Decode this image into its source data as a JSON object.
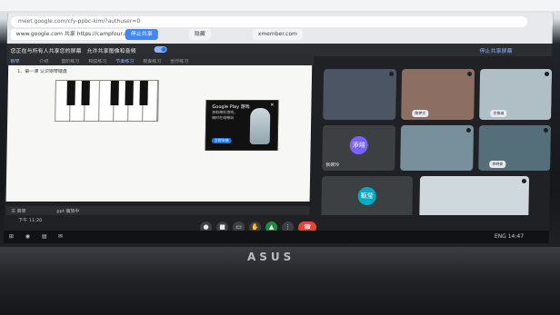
{
  "browser": {
    "url": "meet.google.com/cfy-ppbc-kim/?authuser=0",
    "tabs": [
      "www.google.com 共享 https://campfour.com",
      "停止共享",
      "隐藏",
      "xmember.com"
    ]
  },
  "meeting_bar": {
    "text": "您正在与所有人共享您的屏幕",
    "sub": "允许共享图像和音频",
    "stop_share": "停止共享屏幕"
  },
  "presentation": {
    "tabs": [
      "钢琴",
      "介绍",
      "音阶练习",
      "和弦练习",
      "节奏练习",
      "视奏练习",
      "创作练习"
    ],
    "doc_title": "1、第一课 认识钢琴键盘",
    "ad": {
      "title": "Google Play 游戏",
      "text": "获取精彩游戏，随时在线畅玩",
      "button": "立即安装",
      "close": "✕"
    },
    "next_arrow": "›",
    "footer": {
      "left": "☰ 菜单",
      "mid": "ppt 播放中"
    }
  },
  "participants": [
    {
      "name": "",
      "initials": "",
      "kind": "camera"
    },
    {
      "name": "",
      "pill": "陈伊文",
      "kind": "camera"
    },
    {
      "name": "",
      "pill": "王梓涵",
      "kind": "camera"
    },
    {
      "name": "张婉玲",
      "initials": "添培",
      "kind": "avatar",
      "color": "#7b61ff"
    },
    {
      "name": "",
      "kind": "camera"
    },
    {
      "name": "",
      "pill": "李明俊",
      "kind": "camera"
    },
    {
      "name": "",
      "initials": "甄莹",
      "kind": "avatar",
      "color": "#00acc1"
    },
    {
      "name": "",
      "kind": "camera"
    }
  ],
  "controls": {
    "time": "下午 11:20",
    "buttons": [
      "麦克风",
      "摄像头",
      "字幕",
      "举手",
      "展示",
      "更多"
    ],
    "leave": "挂断"
  },
  "taskbar": {
    "items": [
      "⊞",
      "◉",
      "▤",
      "✉"
    ],
    "tray": "ENG  14:47"
  },
  "device": {
    "brand": "ASUS"
  }
}
